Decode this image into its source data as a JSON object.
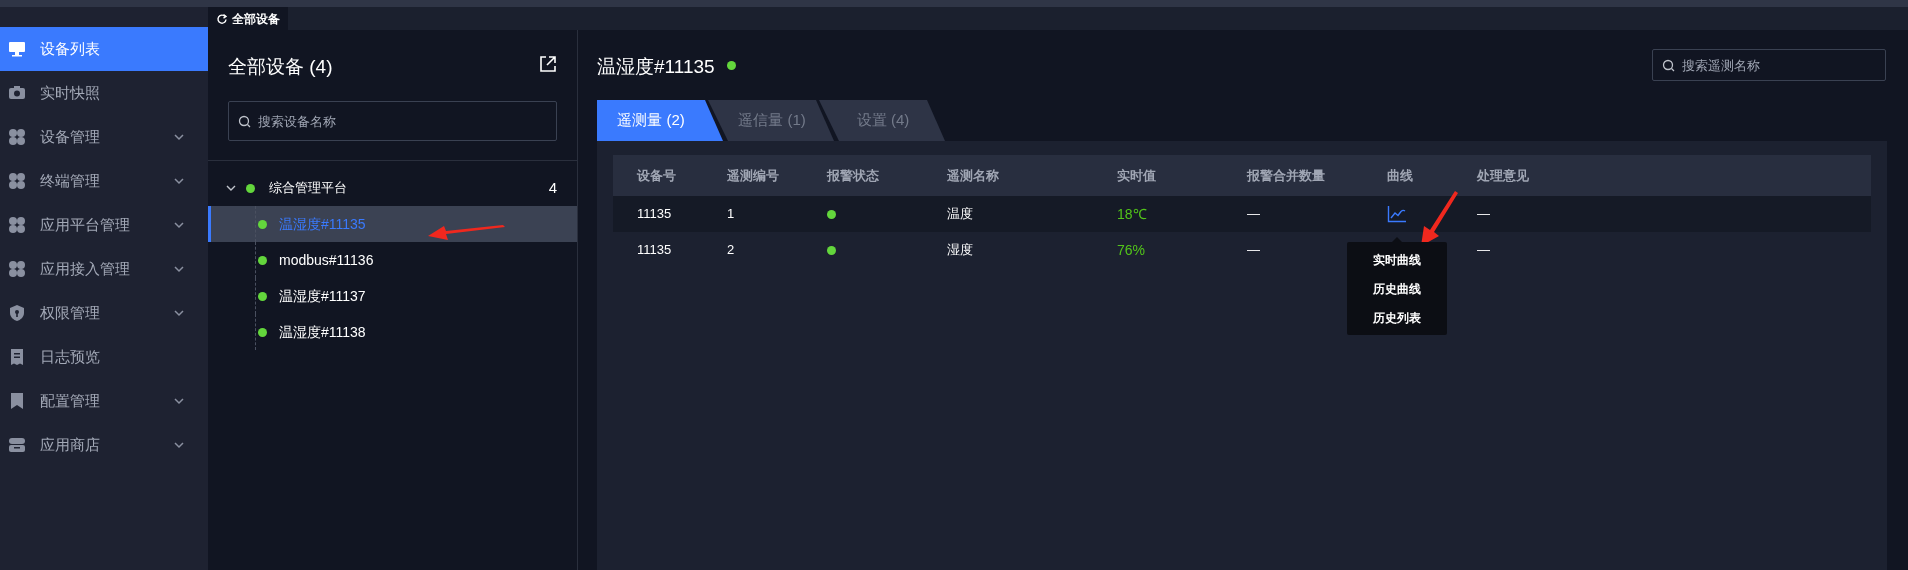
{
  "sidebar": {
    "items": [
      {
        "label": "设备列表",
        "selected": true,
        "has_submenu": false
      },
      {
        "label": "实时快照",
        "selected": false,
        "has_submenu": false
      },
      {
        "label": "设备管理",
        "selected": false,
        "has_submenu": true
      },
      {
        "label": "终端管理",
        "selected": false,
        "has_submenu": true
      },
      {
        "label": "应用平台管理",
        "selected": false,
        "has_submenu": true
      },
      {
        "label": "应用接入管理",
        "selected": false,
        "has_submenu": true
      },
      {
        "label": "权限管理",
        "selected": false,
        "has_submenu": true
      },
      {
        "label": "日志预览",
        "selected": false,
        "has_submenu": false
      },
      {
        "label": "配置管理",
        "selected": false,
        "has_submenu": true
      },
      {
        "label": "应用商店",
        "selected": false,
        "has_submenu": true
      }
    ]
  },
  "page_tabs": [
    {
      "label": "全部设备",
      "selected": true
    }
  ],
  "device_panel": {
    "title": "全部设备 (4)",
    "search": {
      "placeholder": "搜索设备名称"
    },
    "tree": [
      {
        "label": "综合管理平台",
        "count": "4",
        "online": true,
        "expanded": true,
        "children": [
          {
            "label": "温湿度#11135",
            "online": true,
            "selected": true
          },
          {
            "label": "modbus#11136",
            "online": true,
            "selected": false
          },
          {
            "label": "温湿度#11137",
            "online": true,
            "selected": false
          },
          {
            "label": "温湿度#11138",
            "online": true,
            "selected": false
          }
        ]
      }
    ]
  },
  "detail": {
    "title": "温湿度#11135",
    "online": true,
    "search": {
      "placeholder": "搜索遥测名称"
    },
    "tabs": [
      {
        "label": "遥测量 (2)",
        "selected": true
      },
      {
        "label": "遥信量 (1)",
        "selected": false
      },
      {
        "label": "设置 (4)",
        "selected": false
      }
    ],
    "table": {
      "columns": [
        "设备号",
        "遥测编号",
        "报警状态",
        "遥测名称",
        "实时值",
        "报警合并数量",
        "曲线",
        "处理意见"
      ],
      "rows": [
        {
          "device": "11135",
          "number": "1",
          "alarm": false,
          "name": "温度",
          "value": "18℃",
          "merged": "—",
          "curve_icon": true,
          "opinion": "—"
        },
        {
          "device": "11135",
          "number": "2",
          "alarm": false,
          "name": "湿度",
          "value": "76%",
          "merged": "—",
          "curve_icon": false,
          "opinion": "—"
        }
      ]
    },
    "curve_menu": {
      "items": [
        "实时曲线",
        "历史曲线",
        "历史列表"
      ]
    }
  }
}
